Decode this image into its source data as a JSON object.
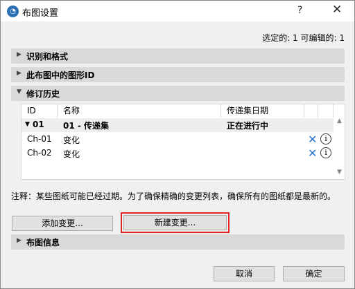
{
  "window": {
    "title": "布图设置",
    "help_label": "?",
    "close_label": "✕"
  },
  "selected_info": "选定的: 1 可编辑的: 1",
  "sections": {
    "id_format": "识别和格式",
    "drawing_id": "此布图中的图形ID",
    "revision_history": "修订历史",
    "layout_info": "布图信息"
  },
  "table": {
    "headers": [
      "ID",
      "名称",
      "传递集日期"
    ],
    "group": {
      "id": "01",
      "name": "01 - 传递集",
      "status": "正在进行中"
    },
    "rows": [
      {
        "id": "Ch-01",
        "name": "变化"
      },
      {
        "id": "Ch-02",
        "name": "变化"
      }
    ]
  },
  "note": "注释：某些图纸可能已经过期。为了确保精确的变更列表，确保所有的图纸都是最新的。",
  "buttons": {
    "add_change": "添加变更...",
    "new_change": "新建变更...",
    "cancel": "取消",
    "ok": "确定"
  },
  "icons": {
    "delete": "x-icon",
    "info": "info-icon"
  },
  "colors": {
    "accent": "#2a72d0",
    "highlight": "#e02424"
  }
}
